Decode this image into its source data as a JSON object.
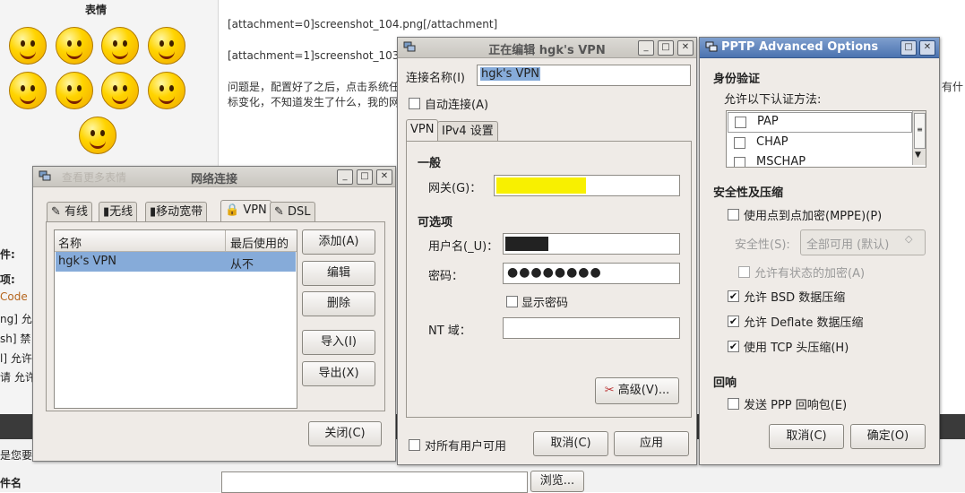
{
  "forum": {
    "emoticons_heading": "表情",
    "more_emoticons": "查看更多表情",
    "attachment0": "[attachment=0]screenshot_104.png[/attachment]",
    "attachment1": "[attachment=1]screenshot_103",
    "question_line1": "问题是，配置好了之后，点击系统任",
    "question_line2": "标变化，不知道发生了什么，我的网",
    "question_tail": "有什",
    "side_labels": [
      "件:",
      "项:",
      "Code",
      "ng] 允许",
      "sh] 禁",
      "l] 允许",
      "请 允许"
    ],
    "bottom_hint": "是您要上",
    "bottom_label": "件名",
    "browse_button": "浏览..."
  },
  "net_window": {
    "title": "网络连接",
    "tabs": [
      "有线",
      "无线",
      "移动宽带",
      "VPN",
      "DSL"
    ],
    "selected_tab": "VPN",
    "columns": [
      "名称",
      "最后使用的"
    ],
    "rows": [
      {
        "name": "hgk's VPN",
        "last_used": "从不"
      }
    ],
    "buttons": {
      "add": "添加(A)",
      "edit": "编辑",
      "delete": "删除",
      "import": "导入(I)",
      "export": "导出(X)",
      "close": "关闭(C)"
    }
  },
  "edit_window": {
    "title": "正在编辑 hgk's VPN",
    "conn_name_label": "连接名称(I)",
    "conn_name_value": "hgk's VPN",
    "auto_connect": "自动连接(A)",
    "tabs": [
      "VPN",
      "IPv4 设置"
    ],
    "general_heading": "一般",
    "gateway_label": "网关(G)：",
    "optional_heading": "可选项",
    "username_label": "用户名(_U)：",
    "password_label": "密码：",
    "password_value": "●●●●●●●●",
    "show_password": "显示密码",
    "nt_domain_label": "NT 域：",
    "advanced_button": "高级(V)...",
    "all_users": "对所有用户可用",
    "cancel_button": "取消(C)",
    "apply_button": "应用"
  },
  "pptp_window": {
    "title": "PPTP Advanced Options",
    "auth_heading": "身份验证",
    "auth_sub": "允许以下认证方法:",
    "auth_methods": [
      "PAP",
      "CHAP",
      "MSCHAP"
    ],
    "security_heading": "安全性及压缩",
    "use_mppe": "使用点到点加密(MPPE)(P)",
    "security_label": "安全性(S):",
    "security_value": "全部可用 (默认)",
    "stateful": "允许有状态的加密(A)",
    "bsd": "允许 BSD 数据压缩",
    "deflate": "允许 Deflate 数据压缩",
    "tcp_header": "使用 TCP 头压缩(H)",
    "echo_heading": "回响",
    "send_echo": "发送 PPP 回响包(E)",
    "cancel_button": "取消(C)",
    "ok_button": "确定(O)"
  }
}
